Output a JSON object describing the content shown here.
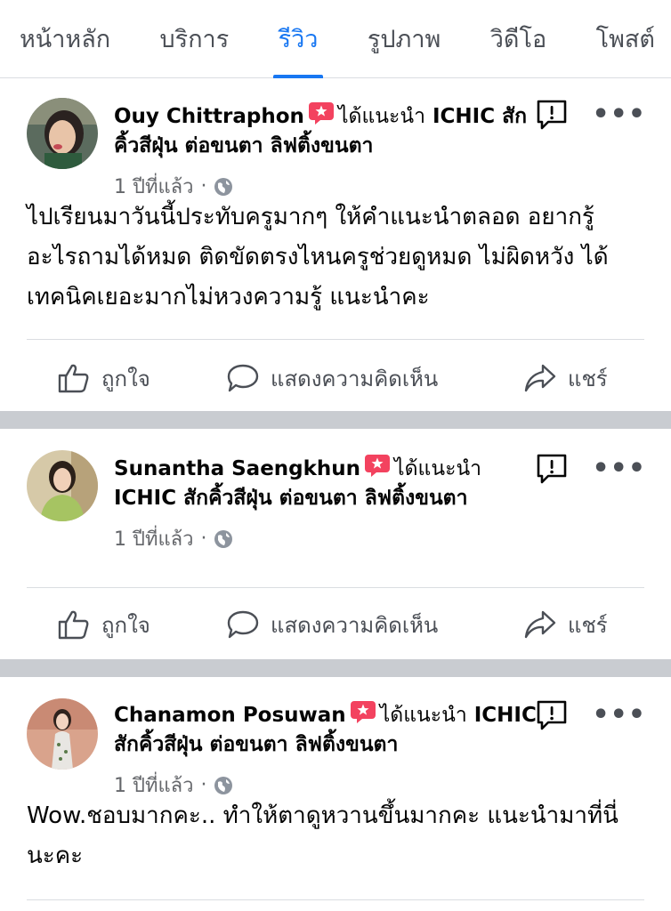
{
  "tabs": [
    {
      "label": "หน้าหลัก",
      "active": false
    },
    {
      "label": "บริการ",
      "active": false
    },
    {
      "label": "รีวิว",
      "active": true
    },
    {
      "label": "รูปภาพ",
      "active": false
    },
    {
      "label": "วิดีโอ",
      "active": false
    },
    {
      "label": "โพสต์",
      "active": false
    }
  ],
  "actions": {
    "like": "ถูกใจ",
    "comment": "แสดงความคิดเห็น",
    "share": "แชร์"
  },
  "colors": {
    "accent": "#1877f2",
    "recommend": "#f3425f",
    "separator": "#c9ccd1"
  },
  "reviews": [
    {
      "name": "Ouy Chittraphon",
      "recommends": "ได้แนะนำ",
      "page_line1": "ICHIC สัก",
      "page_line2": "คิ้วสีฝุ่น ต่อขนตา ลิฟติ้งขนตา",
      "time": "1 ปีที่แล้ว",
      "text": "ไปเรียนมาวันนี้ประทับครูมากๆ ให้คำแนะนำตลอด อยากรู้อะไรถามได้หมด ติดขัดตรงไหนครูช่วยดูหมด ไม่ผิดหวัง ได้เทคนิคเยอะมากไม่หวงความรู้ แนะนำคะ"
    },
    {
      "name": "Sunantha Saengkhun",
      "recommends": "ได้แนะนำ",
      "page_line1": "",
      "page_line2": "ICHIC สักคิ้วสีฝุ่น ต่อขนตา ลิฟติ้งขนตา",
      "time": "1 ปีที่แล้ว",
      "text": ""
    },
    {
      "name": "Chanamon Posuwan",
      "recommends": "ได้แนะนำ",
      "page_line1": "ICHIC",
      "page_line2": "สักคิ้วสีฝุ่น ต่อขนตา ลิฟติ้งขนตา",
      "time": "1 ปีที่แล้ว",
      "text": "Wow.ชอบมากคะ.. ทำให้ตาดูหวานขึ้นมากคะ แนะนำมาที่นี่นะคะ"
    }
  ]
}
